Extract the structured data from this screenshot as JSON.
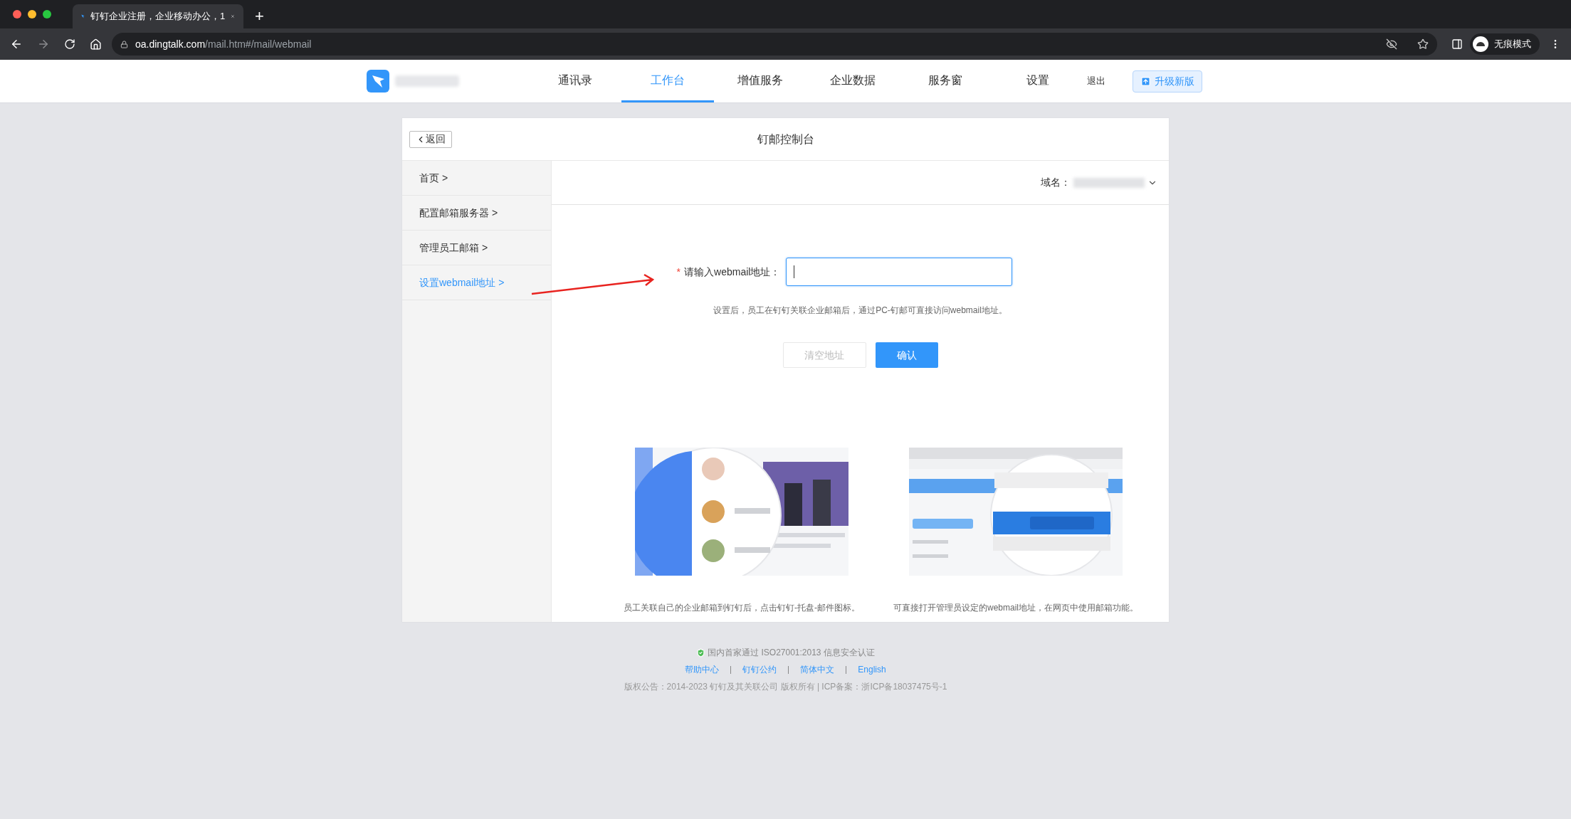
{
  "browser": {
    "tab_title": "钉钉企业注册，企业移动办公，1",
    "new_tab": "+",
    "url_host": "oa.dingtalk.com",
    "url_path": "/mail.htm#/mail/webmail",
    "profile_label": "无痕模式"
  },
  "nav": {
    "items": [
      {
        "label": "通讯录",
        "selected": false
      },
      {
        "label": "工作台",
        "selected": true
      },
      {
        "label": "增值服务",
        "selected": false
      },
      {
        "label": "企业数据",
        "selected": false
      },
      {
        "label": "服务窗",
        "selected": false
      },
      {
        "label": "设置",
        "selected": false
      }
    ],
    "logout": "退出",
    "upgrade": "升级新版"
  },
  "panel": {
    "back": "返回",
    "title": "钉邮控制台"
  },
  "sidebar": {
    "items": [
      {
        "label": "首页 >",
        "selected": false
      },
      {
        "label": "配置邮箱服务器 >",
        "selected": false
      },
      {
        "label": "管理员工邮箱 >",
        "selected": false
      },
      {
        "label": "设置webmail地址 >",
        "selected": true
      }
    ]
  },
  "domain_label": "域名：",
  "form": {
    "required_mark": "*",
    "label": "请输入webmail地址：",
    "focused": true,
    "hint": "设置后，员工在钉钉关联企业邮箱后，通过PC-钉邮可直接访问webmail地址。",
    "clear": {
      "label": "清空地址",
      "disabled": true
    },
    "confirm": "确认"
  },
  "illustrations": [
    {
      "kind": "picture",
      "caption": "员工关联自己的企业邮箱到钉钉后，点击钉钉-托盘-邮件图标。"
    },
    {
      "kind": "picture",
      "caption": "可直接打开管理员设定的webmail地址，在网页中使用邮箱功能。"
    }
  ],
  "footer": {
    "certification": "国内首家通过 ISO27001:2013 信息安全认证",
    "links": [
      "帮助中心",
      "钉钉公约",
      "简体中文",
      "English"
    ],
    "copyright": "版权公告：2014-2023 钉钉及其关联公司 版权所有 | ICP备案：浙ICP备18037475号-1"
  }
}
